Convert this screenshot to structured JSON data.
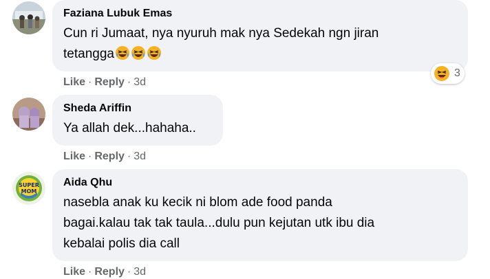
{
  "comments": [
    {
      "author": "Faziana Lubuk Emas",
      "text_line1": "Cun ri Jumaat, nya nyuruh mak nya Sedekah ngn jiran",
      "text_line2": "tetangga",
      "emoji": "laughing-tears-emoji",
      "reaction_icon": "haha-reaction-icon",
      "reaction_count": "3",
      "actions": {
        "like": "Like",
        "reply": "Reply",
        "time": "3d"
      }
    },
    {
      "author": "Sheda Ariffin",
      "text_line1": "Ya allah dek...hahaha..",
      "actions": {
        "like": "Like",
        "reply": "Reply",
        "time": "3d"
      }
    },
    {
      "author": "Aida Qhu",
      "text_line1": "nasebla anak ku kecik ni blom ade food panda",
      "text_line2": "bagai.kalau tak tak taula...dulu pun kejutan utk ibu dia",
      "text_line3": "kebalai polis dia call",
      "avatar_text": "SUPER MOM",
      "actions": {
        "like": "Like",
        "reply": "Reply",
        "time": "3d"
      }
    }
  ],
  "colors": {
    "bubble": "#f0f2f5",
    "meta": "#65676b",
    "text": "#050505",
    "emoji_yellow": "#f7b125"
  }
}
